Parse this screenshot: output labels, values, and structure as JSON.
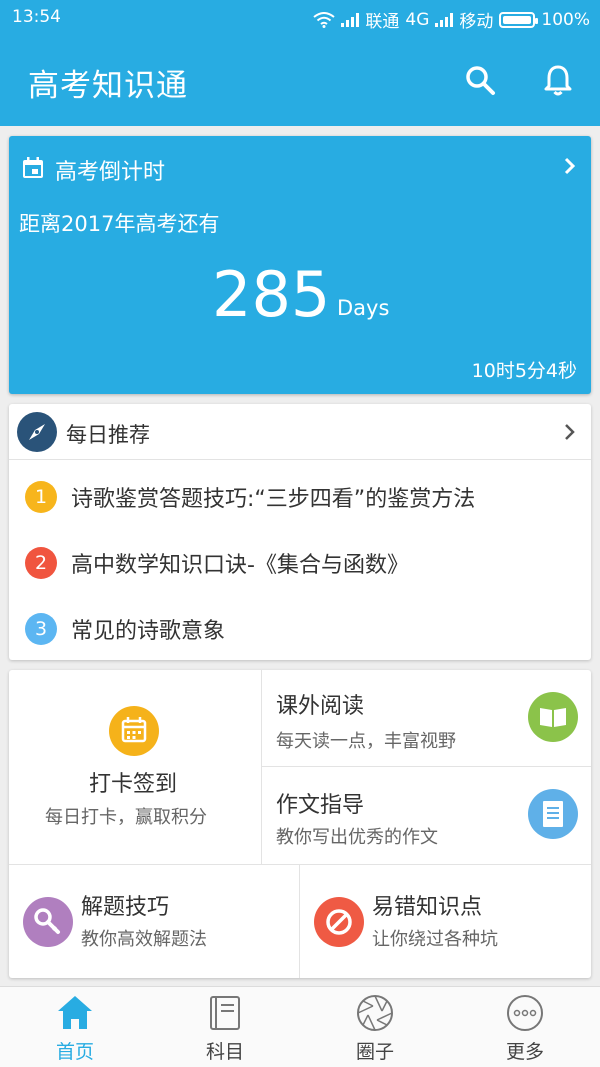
{
  "status_bar": {
    "time": "13:54",
    "carrier1": "联通",
    "network": "4G",
    "carrier2": "移动",
    "battery": "100%"
  },
  "app_bar": {
    "title": "高考知识通",
    "icons": [
      "search-icon",
      "bell-icon"
    ]
  },
  "countdown": {
    "title": "高考倒计时",
    "subtitle": "距离2017年高考还有",
    "days": "285",
    "unit": "Days",
    "remaining": "10时5分4秒"
  },
  "recommend": {
    "title": "每日推荐",
    "items": [
      {
        "num": "1",
        "text": "诗歌鉴赏答题技巧:“三步四看”的鉴赏方法",
        "color": "#f7b51c"
      },
      {
        "num": "2",
        "text": "高中数学知识口诀-《集合与函数》",
        "color": "#f0553f"
      },
      {
        "num": "3",
        "text": "常见的诗歌意象",
        "color": "#5cb6f2"
      }
    ]
  },
  "features": {
    "checkin": {
      "title": "打卡签到",
      "desc": "每日打卡，赢取积分",
      "color": "#f5b21a"
    },
    "reading": {
      "title": "课外阅读",
      "desc": "每天读一点，丰富视野",
      "color": "#8bc34a"
    },
    "writing": {
      "title": "作文指导",
      "desc": "教你写出优秀的作文",
      "color": "#5fb0e8"
    },
    "solving": {
      "title": "解题技巧",
      "desc": "教你高效解题法",
      "color": "#b07fbf"
    },
    "mistakes": {
      "title": "易错知识点",
      "desc": "让你绕过各种坑",
      "color": "#ef5a44"
    }
  },
  "bottom_nav": [
    {
      "label": "首页",
      "icon": "home-icon",
      "active": true
    },
    {
      "label": "科目",
      "icon": "book-icon",
      "active": false
    },
    {
      "label": "圈子",
      "icon": "aperture-icon",
      "active": false
    },
    {
      "label": "更多",
      "icon": "more-icon",
      "active": false
    }
  ],
  "colors": {
    "primary": "#28ace2",
    "background": "#eeeeee"
  }
}
